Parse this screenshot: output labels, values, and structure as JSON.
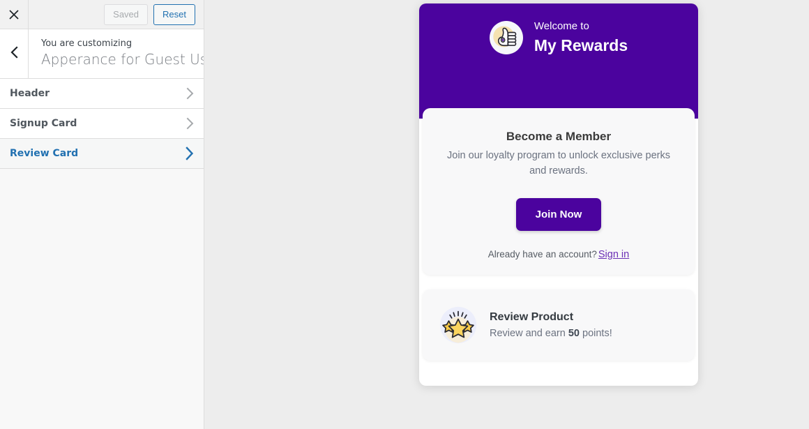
{
  "customizer": {
    "toolbar": {
      "close_icon": "close-x-icon",
      "saved_label": "Saved",
      "reset_label": "Reset"
    },
    "info": {
      "back_icon": "chevron-left-icon",
      "kicker": "You are customizing",
      "title": "Apperance for Guest User"
    },
    "sections": [
      {
        "label": "Header",
        "icon": "chevron-right-icon",
        "active": false
      },
      {
        "label": "Signup Card",
        "icon": "chevron-right-icon",
        "active": false
      },
      {
        "label": "Review Card",
        "icon": "chevron-right-icon",
        "active": true
      }
    ]
  },
  "preview": {
    "header": {
      "logo_icon": "thumbs-up-coins-icon",
      "welcome": "Welcome to",
      "title": "My Rewards"
    },
    "signup_card": {
      "title": "Become a Member",
      "subtitle": "Join our loyalty program to unlock exclusive perks and rewards.",
      "button_label": "Join Now",
      "footer_text": "Already have an account?",
      "signin_label": "Sign in"
    },
    "review_card": {
      "icon": "three-stars-icon",
      "title": "Review Product",
      "subtitle_prefix": "Review and earn ",
      "points": "50",
      "subtitle_suffix": " points!"
    }
  },
  "colors": {
    "brand_purple": "#4B039E",
    "link_blue": "#2271B1",
    "signin_purple": "#6B2FB5",
    "page_bg": "#EDEDED",
    "card_bg": "#F8F8F9"
  }
}
